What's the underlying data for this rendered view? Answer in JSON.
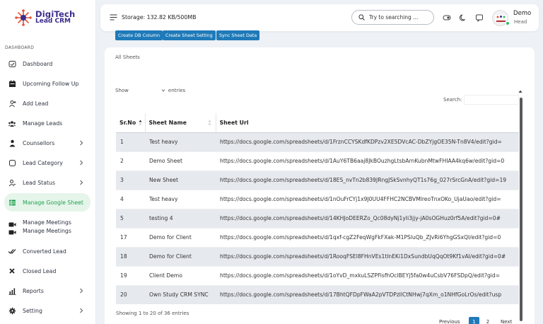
{
  "brand": {
    "name_line1": "DigiTech",
    "name_line2": "Lead CRM"
  },
  "sidebar": {
    "section_label": "DASHBOARD",
    "items": [
      {
        "label": "Dashboard"
      },
      {
        "label": "Upcoming Follow Up"
      },
      {
        "label": "Add Lead"
      },
      {
        "label": "Manage Leads"
      },
      {
        "label": "Counsellors"
      },
      {
        "label": "Lead Category"
      },
      {
        "label": "Lead Status"
      },
      {
        "label": "Manage Google Sheet"
      },
      {
        "label": "Manage Meetings",
        "label2": "Manage Meetings"
      },
      {
        "label": "Converted Lead"
      },
      {
        "label": "Closed Lead"
      },
      {
        "label": "Reports"
      },
      {
        "label": "Setting"
      }
    ],
    "active_color": "#27a154"
  },
  "topbar": {
    "storage": "Storage: 132.82 KB/500MB",
    "search_placeholder": "Try to searching ...",
    "user_name": "Demo",
    "user_role": "Head"
  },
  "main": {
    "breadcrumb": "All Sheets",
    "buttons": [
      "Create DB Column",
      "Create Sheet Setting",
      "Sync Sheet Data"
    ],
    "show_label": "Show",
    "entries_label": "entries",
    "search_label": "Search:",
    "table": {
      "columns": [
        "Sr.No",
        "Sheet Name",
        "Sheet Url"
      ],
      "rows": [
        [
          "1",
          "Test heavy",
          "https://docs.google.com/spreadsheets/d/1FrznCCYSKdfKDPzv2XE5DVcAC-DbZYjgOE35N-Tn8V4/edit?gid="
        ],
        [
          "2",
          "Demo Sheet",
          "https://docs.google.com/spreadsheets/d/1AuY6TB6aaj8JkBOuzhgLtsbArnKubnMtwFHIAA4kq6w/edit?gid=0"
        ],
        [
          "3",
          "New Sheet",
          "https://docs.google.com/spreadsheets/d/18ES_nvTn2b839JRngJSkSvnhyQT1s76g_027rSrcGnA/edit?gid=19"
        ],
        [
          "4",
          "Test heavy",
          "https://docs.google.com/spreadsheets/d/1nOuFrCYj1x9J0UU4FFHC2NCBVMlreoTnxOKo_UjaUao/edit?gid="
        ],
        [
          "5",
          "testing 4",
          "https://docs.google.com/spreadsheets/d/14KHJoDEERZo_Qc08dyNj1yIi3jjy-jA0sOGHuz0rf5A/edit?gid=0#"
        ],
        [
          "17",
          "Demo for Client",
          "https://docs.google.com/spreadsheets/d/1qxf-cgZ2FeqWgFkFXak-M1PSluQb_ZJvRi6YhgGSxQI/edit?gid=0"
        ],
        [
          "18",
          "Demo for Client",
          "https://docs.google.com/spreadsheets/d/1RooqFSEl8FHnVEs1tlnEKi1DxSundbUqQqOt9Kf1vAI/edit?gid=0#"
        ],
        [
          "19",
          "Client Demo",
          "https://docs.google.com/spreadsheets/d/1oYvD_mxkuLSZPFisfhOclBEYj5fa0w4uCsbV76FSDpQ/edit?gid="
        ],
        [
          "20",
          "Own Study CRM SYNC",
          "https://docs.google.com/spreadsheets/d/17BhtQFDpFWaA2pVTDPzllCtNHwj7qXm_o1NHfGoLrOs/edit?usp"
        ]
      ]
    },
    "info": "Showing 1 to 20 of 36 entries",
    "pagination": {
      "prev": "Previous",
      "page1": "1",
      "page2": "2",
      "next": "Next"
    }
  },
  "colors": {
    "primary_button": "#1f7ab9",
    "stripe": "#e6e9ee",
    "online": "#2cc36b"
  }
}
